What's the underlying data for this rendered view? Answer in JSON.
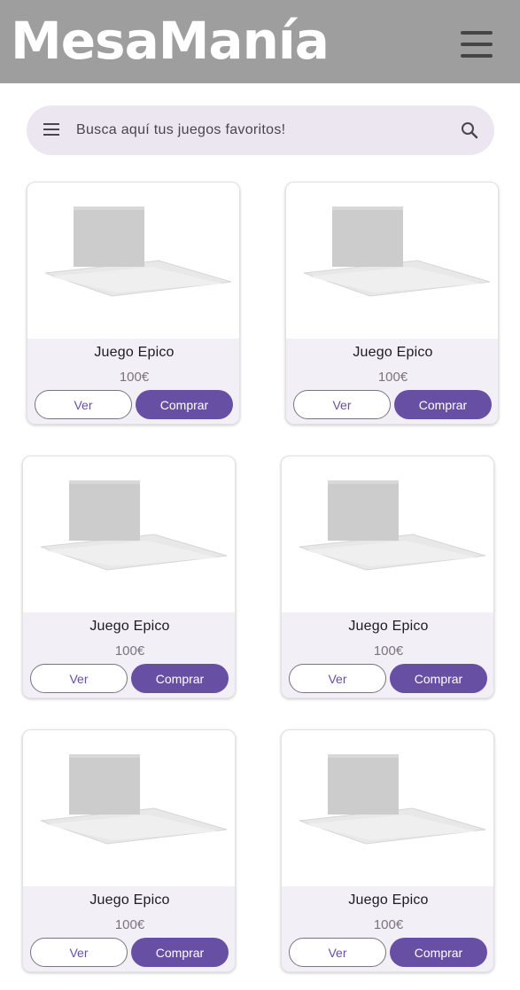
{
  "app": {
    "title": "MesaManía",
    "menu_icon": "hamburger-menu-icon"
  },
  "search": {
    "placeholder": "Busca aquí tus juegos favoritos!",
    "menu_icon": "menu-icon",
    "search_icon": "search-icon"
  },
  "colors": {
    "header_bg": "#9e9e9e",
    "search_bg": "#ece6f0",
    "card_body_bg": "#f3eff7",
    "primary": "#6750a4"
  },
  "products": [
    {
      "title": "Juego Epico",
      "price": "100€",
      "view_label": "Ver",
      "buy_label": "Comprar",
      "image": "board-game-placeholder"
    },
    {
      "title": "Juego Epico",
      "price": "100€",
      "view_label": "Ver",
      "buy_label": "Comprar",
      "image": "board-game-placeholder"
    },
    {
      "title": "Juego Epico",
      "price": "100€",
      "view_label": "Ver",
      "buy_label": "Comprar",
      "image": "board-game-placeholder"
    },
    {
      "title": "Juego Epico",
      "price": "100€",
      "view_label": "Ver",
      "buy_label": "Comprar",
      "image": "board-game-placeholder"
    },
    {
      "title": "Juego Epico",
      "price": "100€",
      "view_label": "Ver",
      "buy_label": "Comprar",
      "image": "board-game-placeholder"
    },
    {
      "title": "Juego Epico",
      "price": "100€",
      "view_label": "Ver",
      "buy_label": "Comprar",
      "image": "board-game-placeholder"
    }
  ]
}
